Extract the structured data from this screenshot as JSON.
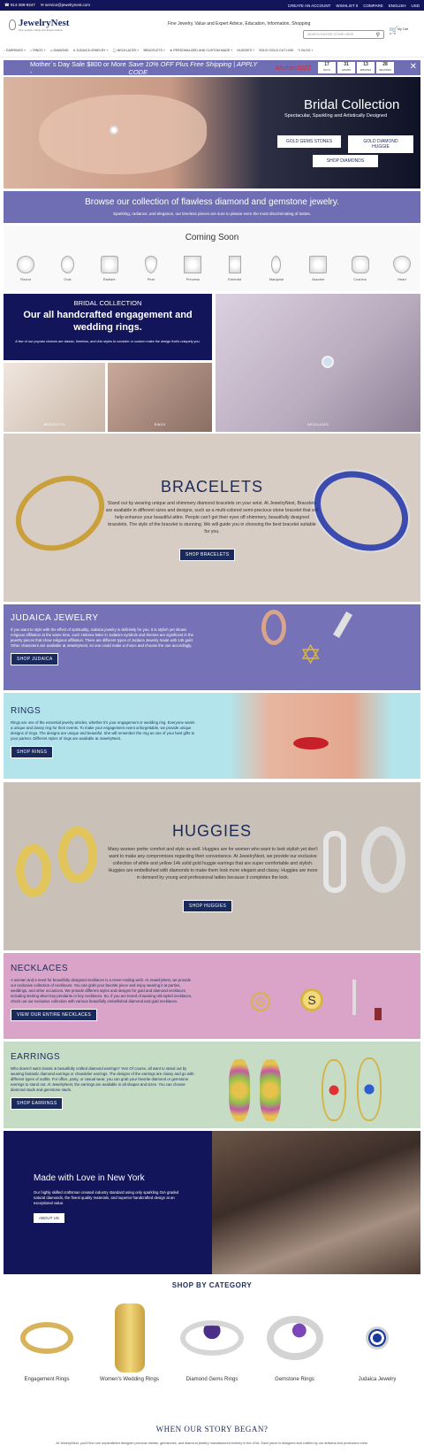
{
  "topbar": {
    "phone": "914-369-9247",
    "email": "service@jewelrynest.com",
    "links": [
      "CREATE AN ACCOUNT",
      "WISHLIST 0",
      "COMPARE",
      "ENGLISH",
      "USD"
    ]
  },
  "header": {
    "logo": "JewelryNest",
    "logo_tagline": "Fine Jewelry Value and Expert Advice",
    "tagline": "Fine Jewelry, Value and Expert Advice, Education, Information, Shopping",
    "search_placeholder": "SEARCH ENTIRE STORE HERE",
    "cart_label": "My Cart"
  },
  "nav": [
    "EARRINGS",
    "RINGS",
    "DIAMOND",
    "JUDAICA JEWELRY",
    "NECKLACES",
    "BRACELETS",
    "PERSONALIZED AND CUSTOM MADE",
    "HUGGIES",
    "SOLID GOLD CUT LINK",
    "BLOG"
  ],
  "promo": {
    "text": "Mother`s Day Sale $800 or More - ",
    "offer": "Save 10% OFF Plus Free Shipping | APPLY CODE ",
    "code": "Mother2023",
    "countdown": [
      {
        "value": "17",
        "unit": "DAYS"
      },
      {
        "value": "31",
        "unit": "HOURS"
      },
      {
        "value": "13",
        "unit": "MINUTES"
      },
      {
        "value": "28",
        "unit": "SECONDS"
      }
    ],
    "close": "✕"
  },
  "hero": {
    "title": "Bridal Collection",
    "subtitle": "Spectacular, Sparkling and Artistically Designed",
    "btn1": "GOLD GEMS STONES",
    "btn2": "GOLD DIAMOND HUGGIE",
    "btn3": "SHOP DIAMONDS"
  },
  "browse": {
    "title": "Browse our collection of flawless diamond and gemstone jewelry.",
    "text": "Sparkling, radiance, and elegance, our timeless pieces are sure to please even the most discriminating of tastes."
  },
  "coming_soon": {
    "title": "Coming Soon",
    "shapes": [
      "Round",
      "Oval",
      "Radiant",
      "Pear",
      "Princess",
      "Emerald",
      "Marquise",
      "Asscher",
      "Cushion",
      "Heart"
    ]
  },
  "bridal": {
    "kicker": "BRIDAL COLLECTION",
    "title": "Our all handcrafted engagement and wedding rings.",
    "text": "A few of our popular choices are classic, timeless, and chic styles to consider or custom make the design that's uniquely you.",
    "tiles": [
      "BRACELETS",
      "RINGS",
      "NECKLACES"
    ]
  },
  "bracelets": {
    "title": "BRACELETS",
    "text": "Stand out by wearing unique and shimmery diamond bracelets on your wrist. At JewelryNest, Bracelets are available in different sizes and designs, such as a multi-colored semi-precious stone bracelet that will help enhance your beautiful attire. People can't get their eyes off shimmery, beautifully designed bracelets. The style of the bracelet is stunning. We will guide you in choosing the best bracelet suitable for you.",
    "button": "SHOP BRACELETS"
  },
  "judaica": {
    "title": "JUDAICA JEWELRY",
    "text": "If you want to style with the effect of spirituality, Judaica jewelry is definitely for you. It is stylish yet shows religious affiliation at the same time, such Hebrew letter in Judaism symbols and themes are significant in the jewelry pieces that show religious affiliation. There are different types of Judaica Jewelry made with 14k gold. Other characters are available at JewelryNest, so one could make a choice and choose the one accordingly.",
    "button": "SHOP JUDAICA"
  },
  "rings": {
    "title": "RINGS",
    "text": "Rings are one of the essential jewelry articles, whether it's your engagement or wedding ring. Everyone wants a unique and classy ring for their events. To make your engagement event unforgettable, we provide unique designs of rings. The designs are unique and beautiful. She will remember the ring as one of your best gifts to your partner. Different styles of rings are available at JewelryNest.",
    "button": "SHOP RINGS"
  },
  "huggies": {
    "title": "HUGGIES",
    "text": "Many women prefer comfort and style as well. Huggies are for women who want to look stylish yet don't want to make any compromises regarding their convenience. At JewelryNest, we provide our exclusive collection of white and yellow 14k solid gold huggie earrings that are super comfortable and stylish. Huggies are embellished with diamonds to make them look more elegant and classy. Huggies are more in demand by young and professional ladies because it completes the look.",
    "button": "SHOP HUGGIES"
  },
  "necklaces": {
    "title": "NECKLACES",
    "text": "A woman and a need for beautifully designed necklaces is a never-ending wish. At JewelryNest, we provide our exclusive collection of necklaces. You can grab your favorite piece and enjoy wearing it at parties, weddings, and other occasions. We provide different styles and designs for gold and diamond necklaces including sterling silver key pendants or key necklaces. So, if you are bored of wearing old-styled necklaces, check out our exclusive collection with various beautifully embellished diamond and gold necklaces.",
    "button": "VIEW OUR ENTIRE NECKLACES"
  },
  "earrings": {
    "title": "EARRINGS",
    "text": "Who doesn't want classic & beautifully crafted diamond earrings? Yes! Of course, all want to stand out by wearing fantastic diamond earrings or chandelier earrings. The designs of the earrings are classy and go with different types of outfits. For office, party, or casual wear, you can grab your favorite diamond or gemstone earrings to stand out. At JewelryNest, the earrings are available in all shapes and sizes. You can choose diamond studs and gemstone studs.",
    "button": "SHOP EARRINGS"
  },
  "love": {
    "title": "Made with Love in New York",
    "text": "Our highly skilled craftsman created industry standard using only sparkling GIA graded natural diamonds, the finest quality materials, and superior handcrafted design at an exceptional value.",
    "button": "ABOUT US"
  },
  "categories": {
    "title": "SHOP BY CATEGORY",
    "items": [
      "Engagement Rings",
      "Women's Wedding Rings",
      "Diamond Gems Rings",
      "Gemstone Rings",
      "Judaica Jewelry"
    ]
  },
  "story": {
    "title": "WHEN OUR STORY BEGAN?",
    "text": "At JewelryNest, you'll find one unparalleled designer precious metals, gemstones, and diamond jewelry manufactured entirely in the USA. Each piece is designed and crafted by our artisans and production crew."
  },
  "colors": {
    "navy": "#13155a",
    "violet": "#6f6eb5",
    "promo_code": "#e2262a"
  }
}
